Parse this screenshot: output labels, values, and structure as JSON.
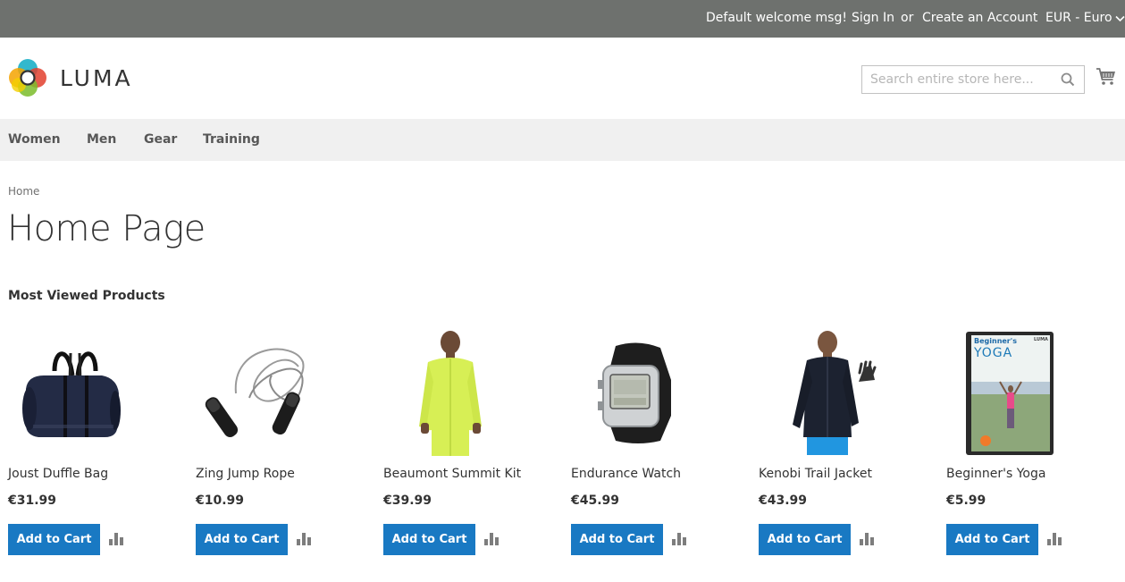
{
  "top_bar": {
    "welcome": "Default welcome msg!",
    "sign_in": "Sign In",
    "or": "or",
    "create_account": "Create an Account",
    "currency": "EUR - Euro"
  },
  "header": {
    "logo_text": "LUMA",
    "search_placeholder": "Search entire store here..."
  },
  "nav": {
    "items": [
      "Women",
      "Men",
      "Gear",
      "Training"
    ]
  },
  "breadcrumb": {
    "home": "Home"
  },
  "page": {
    "title": "Home Page",
    "section_title": "Most Viewed Products"
  },
  "products": [
    {
      "name": "Joust Duffle Bag",
      "price": "€31.99",
      "button": "Add to Cart"
    },
    {
      "name": "Zing Jump Rope",
      "price": "€10.99",
      "button": "Add to Cart"
    },
    {
      "name": "Beaumont Summit Kit",
      "price": "€39.99",
      "button": "Add to Cart"
    },
    {
      "name": "Endurance Watch",
      "price": "€45.99",
      "button": "Add to Cart"
    },
    {
      "name": "Kenobi Trail Jacket",
      "price": "€43.99",
      "button": "Add to Cart"
    },
    {
      "name": "Beginner's Yoga",
      "price": "€5.99",
      "button": "Add to Cart"
    }
  ],
  "dvd_cover": {
    "brand": "LUMA",
    "title_top": "Beginner's",
    "title_main": "YOGA"
  },
  "colors": {
    "top_bar": "#6e716e",
    "nav_bg": "#f0f0f0",
    "button": "#1979c3"
  }
}
